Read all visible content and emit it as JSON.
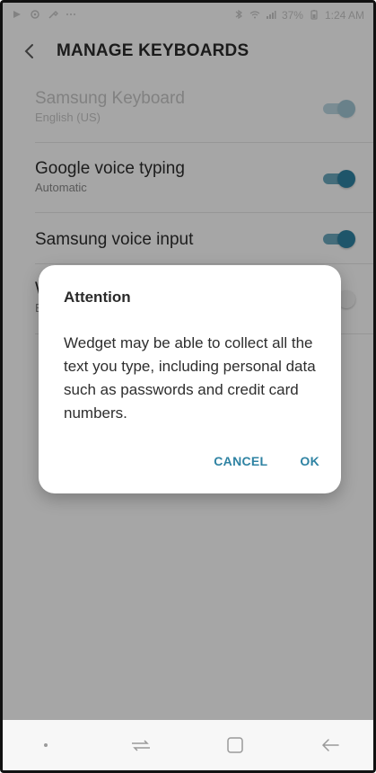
{
  "status_bar": {
    "battery": "37%",
    "time": "1:24 AM",
    "icons_left": [
      "play-icon",
      "settings-icon",
      "tool-icon",
      "more-icon"
    ],
    "icons_right": [
      "bluetooth-icon",
      "wifi-icon",
      "signal-icon",
      "battery-icon"
    ]
  },
  "appbar": {
    "title": "MANAGE KEYBOARDS"
  },
  "keyboards": [
    {
      "label": "Samsung Keyboard",
      "sub": "English (US)",
      "state": "on",
      "disabled": true
    },
    {
      "label": "Google voice typing",
      "sub": "Automatic",
      "state": "on",
      "disabled": false
    },
    {
      "label": "Samsung voice input",
      "sub": "",
      "state": "on",
      "disabled": false
    },
    {
      "label": "W",
      "sub": "E",
      "state": "off",
      "disabled": false
    }
  ],
  "dialog": {
    "title": "Attention",
    "message": "Wedget may be able to collect all the text you type, including personal data such as passwords and credit card numbers.",
    "cancel": "CANCEL",
    "ok": "OK"
  },
  "colors": {
    "accent": "#2f83a3",
    "track_on": "#6aa8be"
  }
}
